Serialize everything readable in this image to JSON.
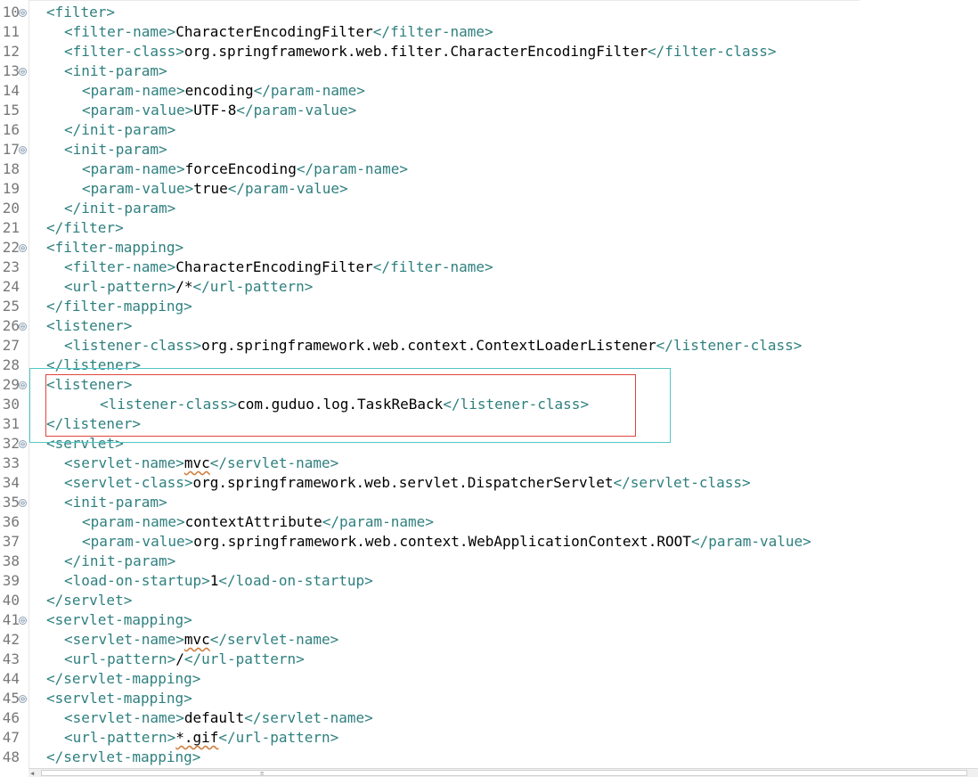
{
  "editor": {
    "lines": [
      {
        "n": "10",
        "fold": true,
        "indent": 0,
        "open": "<filter>",
        "text": "",
        "close": ""
      },
      {
        "n": "11",
        "fold": false,
        "indent": 1,
        "open": "<filter-name>",
        "text": "CharacterEncodingFilter",
        "close": "</filter-name>"
      },
      {
        "n": "12",
        "fold": false,
        "indent": 1,
        "open": "<filter-class>",
        "text": "org.springframework.web.filter.CharacterEncodingFilter",
        "close": "</filter-class>"
      },
      {
        "n": "13",
        "fold": true,
        "indent": 1,
        "open": "<init-param>",
        "text": "",
        "close": ""
      },
      {
        "n": "14",
        "fold": false,
        "indent": 2,
        "open": "<param-name>",
        "text": "encoding",
        "close": "</param-name>"
      },
      {
        "n": "15",
        "fold": false,
        "indent": 2,
        "open": "<param-value>",
        "text": "UTF-8",
        "close": "</param-value>"
      },
      {
        "n": "16",
        "fold": false,
        "indent": 1,
        "open": "</init-param>",
        "text": "",
        "close": ""
      },
      {
        "n": "17",
        "fold": true,
        "indent": 1,
        "open": "<init-param>",
        "text": "",
        "close": ""
      },
      {
        "n": "18",
        "fold": false,
        "indent": 2,
        "open": "<param-name>",
        "text": "forceEncoding",
        "close": "</param-name>"
      },
      {
        "n": "19",
        "fold": false,
        "indent": 2,
        "open": "<param-value>",
        "text": "true",
        "close": "</param-value>"
      },
      {
        "n": "20",
        "fold": false,
        "indent": 1,
        "open": "</init-param>",
        "text": "",
        "close": ""
      },
      {
        "n": "21",
        "fold": false,
        "indent": 0,
        "open": "</filter>",
        "text": "",
        "close": ""
      },
      {
        "n": "22",
        "fold": true,
        "indent": 0,
        "open": "<filter-mapping>",
        "text": "",
        "close": ""
      },
      {
        "n": "23",
        "fold": false,
        "indent": 1,
        "open": "<filter-name>",
        "text": "CharacterEncodingFilter",
        "close": "</filter-name>"
      },
      {
        "n": "24",
        "fold": false,
        "indent": 1,
        "open": "<url-pattern>",
        "text": "/*",
        "close": "</url-pattern>"
      },
      {
        "n": "25",
        "fold": false,
        "indent": 0,
        "open": "</filter-mapping>",
        "text": "",
        "close": ""
      },
      {
        "n": "26",
        "fold": true,
        "indent": 0,
        "open": "<listener>",
        "text": "",
        "close": ""
      },
      {
        "n": "27",
        "fold": false,
        "indent": 1,
        "open": "<listener-class>",
        "text": "org.springframework.web.context.ContextLoaderListener",
        "close": "</listener-class>"
      },
      {
        "n": "28",
        "fold": false,
        "indent": 0,
        "open": "</listener>",
        "text": "",
        "close": ""
      },
      {
        "n": "29",
        "fold": true,
        "indent": 0,
        "open": "<listener>",
        "text": "",
        "close": ""
      },
      {
        "n": "30",
        "fold": false,
        "indent": 3,
        "open": "<listener-class>",
        "text": "com.guduo.log.TaskReBack",
        "close": "</listener-class>"
      },
      {
        "n": "31",
        "fold": false,
        "indent": 0,
        "open": "</listener>",
        "text": "",
        "close": ""
      },
      {
        "n": "32",
        "fold": true,
        "indent": 0,
        "open": "<servlet>",
        "text": "",
        "close": ""
      },
      {
        "n": "33",
        "fold": false,
        "indent": 1,
        "open": "<servlet-name>",
        "text": "mvc",
        "close": "</servlet-name>",
        "squiggle": true
      },
      {
        "n": "34",
        "fold": false,
        "indent": 1,
        "open": "<servlet-class>",
        "text": "org.springframework.web.servlet.DispatcherServlet",
        "close": "</servlet-class>"
      },
      {
        "n": "35",
        "fold": true,
        "indent": 1,
        "open": "<init-param>",
        "text": "",
        "close": ""
      },
      {
        "n": "36",
        "fold": false,
        "indent": 2,
        "open": "<param-name>",
        "text": "contextAttribute",
        "close": "</param-name>"
      },
      {
        "n": "37",
        "fold": false,
        "indent": 2,
        "open": "<param-value>",
        "text": "org.springframework.web.context.WebApplicationContext.ROOT",
        "close": "</param-value>"
      },
      {
        "n": "38",
        "fold": false,
        "indent": 1,
        "open": "</init-param>",
        "text": "",
        "close": ""
      },
      {
        "n": "39",
        "fold": false,
        "indent": 1,
        "open": "<load-on-startup>",
        "text": "1",
        "close": "</load-on-startup>"
      },
      {
        "n": "40",
        "fold": false,
        "indent": 0,
        "open": "</servlet>",
        "text": "",
        "close": ""
      },
      {
        "n": "41",
        "fold": true,
        "indent": 0,
        "open": "<servlet-mapping>",
        "text": "",
        "close": ""
      },
      {
        "n": "42",
        "fold": false,
        "indent": 1,
        "open": "<servlet-name>",
        "text": "mvc",
        "close": "</servlet-name>",
        "squiggle": true
      },
      {
        "n": "43",
        "fold": false,
        "indent": 1,
        "open": "<url-pattern>",
        "text": "/",
        "close": "</url-pattern>"
      },
      {
        "n": "44",
        "fold": false,
        "indent": 0,
        "open": "</servlet-mapping>",
        "text": "",
        "close": ""
      },
      {
        "n": "45",
        "fold": true,
        "indent": 0,
        "open": "<servlet-mapping>",
        "text": "",
        "close": ""
      },
      {
        "n": "46",
        "fold": false,
        "indent": 1,
        "open": "<servlet-name>",
        "text": "default",
        "close": "</servlet-name>"
      },
      {
        "n": "47",
        "fold": false,
        "indent": 1,
        "open": "<url-pattern>",
        "text": "*.gif",
        "close": "</url-pattern>",
        "squiggle": true
      },
      {
        "n": "48",
        "fold": false,
        "indent": 0,
        "open": "</servlet-mapping>",
        "text": "",
        "close": ""
      }
    ],
    "fold_glyph": "⊖",
    "scroll_left_glyph": "◀",
    "scroll_grip_glyph": "≡"
  },
  "colors": {
    "tag": "#2f7f7f",
    "text": "#000000",
    "line_number": "#787878",
    "highlight_red": "#e0443d",
    "highlight_cyan": "#53c6c6"
  }
}
